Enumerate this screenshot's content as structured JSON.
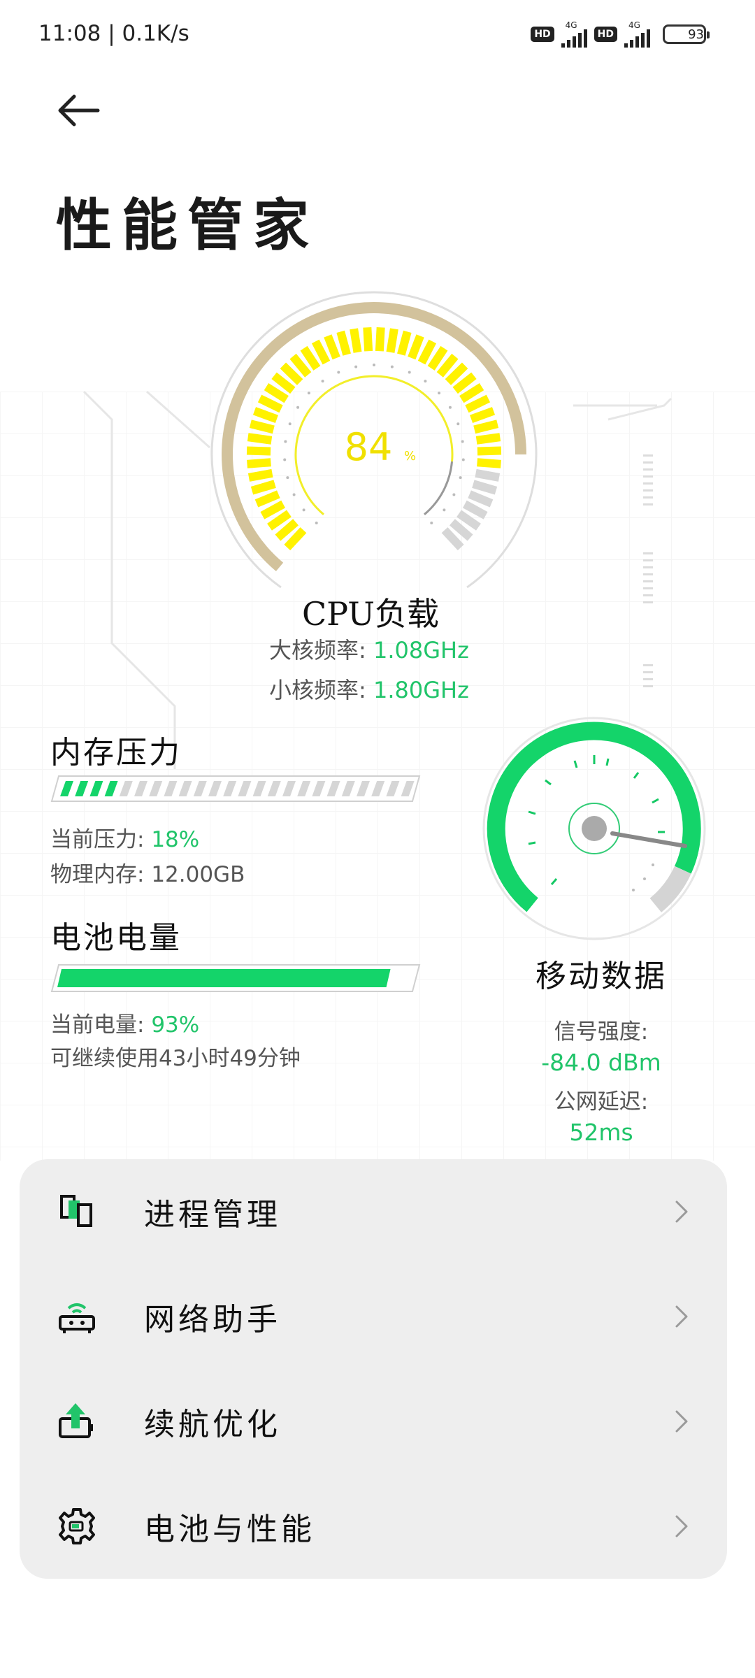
{
  "status_bar": {
    "time_speed": "11:08 | 0.1K/s",
    "hd1": "HD",
    "net1": "4G",
    "hd2": "HD",
    "net2": "4G",
    "battery": "93"
  },
  "header": {
    "title": "性能管家"
  },
  "cpu": {
    "percent": "84",
    "percent_unit": "%",
    "title": "CPU负载",
    "big_core_label": "大核频率:",
    "big_core_value": "1.08GHz",
    "small_core_label": "小核频率:",
    "small_core_value": "1.80GHz"
  },
  "memory": {
    "title": "内存压力",
    "pressure_label": "当前压力:",
    "pressure_value": "18%",
    "pressure_level": 0.18,
    "physical_label": "物理内存:",
    "physical_value": "12.00GB"
  },
  "battery_section": {
    "title": "电池电量",
    "level_label": "当前电量:",
    "level_value": "93%",
    "level": 0.93,
    "remaining": "可继续使用43小时49分钟"
  },
  "mobile_data": {
    "title": "移动数据",
    "signal_label": "信号强度:",
    "signal_value": "-84.0 dBm",
    "latency_label": "公网延迟:",
    "latency_value": "52ms"
  },
  "menu": {
    "items": [
      {
        "label": "进程管理",
        "icon": "process-icon"
      },
      {
        "label": "网络助手",
        "icon": "router-icon"
      },
      {
        "label": "续航优化",
        "icon": "battery-boost-icon"
      },
      {
        "label": "电池与性能",
        "icon": "gear-icon"
      }
    ]
  },
  "colors": {
    "accent_green": "#21c46a",
    "cpu_yellow": "#fff000",
    "gauge_tan": "#d2c29c"
  }
}
